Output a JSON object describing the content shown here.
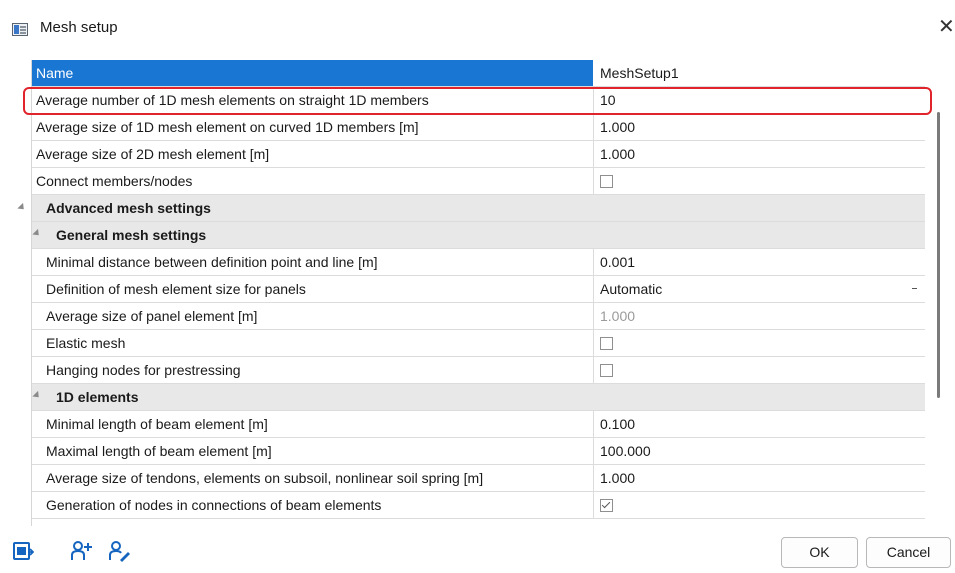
{
  "window": {
    "title": "Mesh setup",
    "close_glyph": "✕"
  },
  "grid": {
    "header": {
      "name": "Name",
      "value": "MeshSetup1"
    },
    "rows": [
      {
        "label": "Average number of 1D mesh elements on straight 1D members",
        "value": "10"
      },
      {
        "label": "Average size of 1D mesh element on curved 1D members [m]",
        "value": "1.000"
      },
      {
        "label": "Average size of 2D mesh element [m]",
        "value": "1.000"
      },
      {
        "label": "Connect members/nodes",
        "checked": false
      },
      {
        "label": "Advanced mesh settings"
      },
      {
        "label": "General mesh settings"
      },
      {
        "label": "Minimal distance between definition point and line [m]",
        "value": "0.001"
      },
      {
        "label": "Definition of mesh element size for panels",
        "value": "Automatic"
      },
      {
        "label": "Average size of panel element [m]",
        "value": "1.000"
      },
      {
        "label": "Elastic mesh",
        "checked": false
      },
      {
        "label": "Hanging nodes for prestressing",
        "checked": false
      },
      {
        "label": "1D elements"
      },
      {
        "label": "Minimal length of beam element [m]",
        "value": "0.100"
      },
      {
        "label": "Maximal length of beam element [m]",
        "value": "100.000"
      },
      {
        "label": "Average size of tendons, elements on subsoil, nonlinear soil spring [m]",
        "value": "1.000"
      },
      {
        "label": "Generation of nodes in connections of beam elements",
        "checked": true
      }
    ]
  },
  "footer": {
    "ok_label": "OK",
    "cancel_label": "Cancel"
  },
  "icons": {
    "export": "export-table-icon",
    "add_user": "add-user-icon",
    "edit_user": "edit-user-icon"
  },
  "colors": {
    "header_bg": "#1976d2",
    "highlight": "#e1242b",
    "group_bg": "#e8e8e8",
    "icon_blue": "#1565c0"
  }
}
